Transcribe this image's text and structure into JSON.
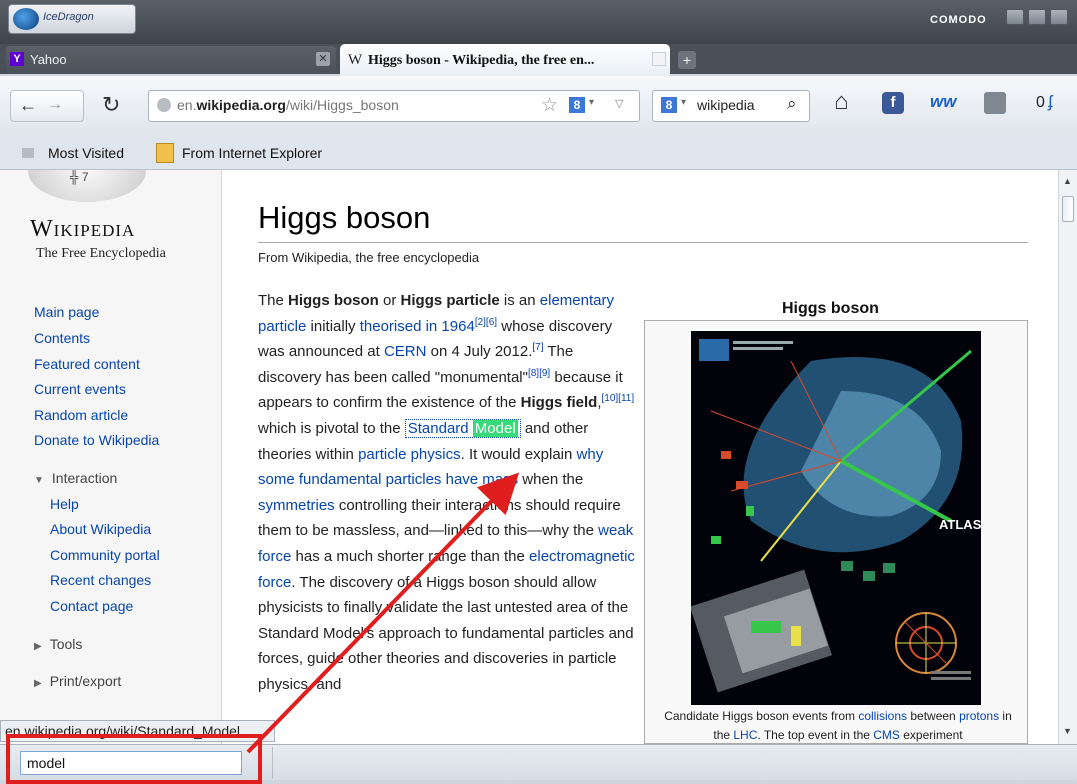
{
  "browser": {
    "app_name": "IceDragon",
    "brand": "COMODO",
    "tabs": [
      {
        "favicon": "Y",
        "label": "Yahoo"
      },
      {
        "favicon": "W",
        "label": "Higgs boson - Wikipedia, the free en..."
      }
    ],
    "new_tab": "+",
    "nav": {
      "back_icon": "←",
      "forward_icon": "→",
      "reload_icon": "↻",
      "url_prefix": "en.",
      "url_domain": "wikipedia.org",
      "url_path": "/wiki/Higgs_boson",
      "bookmark_service": "8",
      "search_engine": "8",
      "search_text": "wikipedia",
      "counter": "0"
    },
    "bookmarks": [
      "Most Visited",
      "From Internet Explorer"
    ]
  },
  "sidebar": {
    "wordmark": "Wikipedia",
    "tagline": "The Free Encyclopedia",
    "main_links": [
      "Main page",
      "Contents",
      "Featured content",
      "Current events",
      "Random article",
      "Donate to Wikipedia"
    ],
    "interaction_header": "Interaction",
    "interaction_links": [
      "Help",
      "About Wikipedia",
      "Community portal",
      "Recent changes",
      "Contact page"
    ],
    "tools_header": "Tools",
    "print_header": "Print/export"
  },
  "article": {
    "title": "Higgs boson",
    "subtitle": "From Wikipedia, the free encyclopedia",
    "p": {
      "t1": "The ",
      "b1": "Higgs boson",
      "t2": " or ",
      "b2": "Higgs particle",
      "t3": " is an ",
      "l1": "elementary particle",
      "t4": " initially ",
      "l2": "theorised in 1964",
      "r1": "[2][6]",
      "t5": " whose discovery was announced at ",
      "l3": "CERN",
      "t6": " on 4 July 2012.",
      "r2": "[7]",
      "t7": " The discovery has been called \"monumental\"",
      "r3": "[8][9]",
      "t8": " because it appears to confirm the existence of the ",
      "b3": "Higgs field",
      "t9": ",",
      "r4": "[10][11]",
      "t10": " which is pivotal to the ",
      "l4a": "Standard ",
      "l4b": "Model",
      "t11": " and other theories within ",
      "l5": "particle physics",
      "t12": ". It would explain ",
      "l6": "why some fundamental particles have mass",
      "t13": " when the ",
      "l7": "symmetries",
      "t14": " controlling their interactions should require them to be massless, and—linked to this—why the ",
      "l8": "weak force",
      "t15": " has a much shorter range than the ",
      "l9": "electromagnetic force",
      "t16": ". The discovery of a Higgs boson should allow physicists to finally validate the last untested area of the Standard Model's approach to fundamental particles and forces, guide other theories and discoveries in particle physics, and"
    },
    "infobox": {
      "title": "Higgs boson",
      "image_label": "ATLAS",
      "caption": {
        "t1": "Candidate Higgs boson events from ",
        "l1": "collisions",
        "t2": " between ",
        "l2": "protons",
        "t3": " in the ",
        "l3": "LHC",
        "t4": ". The top event in the ",
        "l4": "CMS",
        "t5": " experiment"
      }
    }
  },
  "status_url": "en.wikipedia.org/wiki/Standard_Model",
  "find": {
    "query": "model"
  },
  "colors": {
    "annotation": "#e01e1e",
    "link": "#0645ad",
    "find_highlight": "#38d978"
  }
}
